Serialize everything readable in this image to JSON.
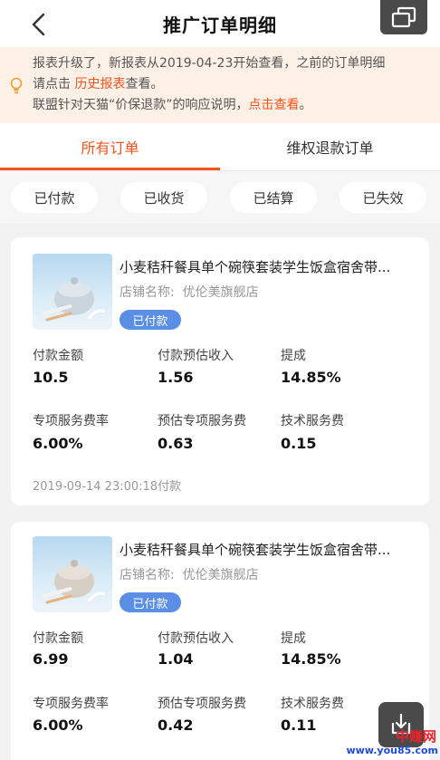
{
  "header": {
    "title": "推广订单明细"
  },
  "notice": {
    "line1": "报表升级了，新报表从2019-04-23开始查看，之前的订单明细",
    "line2_prefix": "请点击 ",
    "line2_link": "历史报表",
    "line2_suffix": "查看。",
    "line3_prefix": "联盟针对天猫“价保退款”的响应说明，",
    "line3_link": "点击查看",
    "line3_suffix": "。"
  },
  "tabs": [
    {
      "label": "所有订单",
      "active": true
    },
    {
      "label": "维权退款订单",
      "active": false
    }
  ],
  "filters": [
    "已付款",
    "已收货",
    "已结算",
    "已失效"
  ],
  "orders": [
    {
      "title": "小麦秸秆餐具单个碗筷套装学生饭盒宿舍带...",
      "shop_label": "店铺名称:",
      "shop": "优伦美旗舰店",
      "status": "已付款",
      "stats": [
        {
          "label": "付款金额",
          "value": "10.5"
        },
        {
          "label": "付款预估收入",
          "value": "1.56"
        },
        {
          "label": "提成",
          "value": "14.85%"
        },
        {
          "label": "专项服务费率",
          "value": "6.00%"
        },
        {
          "label": "预估专项服务费",
          "value": "0.63"
        },
        {
          "label": "技术服务费",
          "value": "0.15"
        }
      ],
      "time": "2019-09-14 23:00:18付款"
    },
    {
      "title": "小麦秸秆餐具单个碗筷套装学生饭盒宿舍带...",
      "shop_label": "店铺名称:",
      "shop": "优伦美旗舰店",
      "status": "已付款",
      "stats": [
        {
          "label": "付款金额",
          "value": "6.99"
        },
        {
          "label": "付款预估收入",
          "value": "1.04"
        },
        {
          "label": "提成",
          "value": "14.85%"
        },
        {
          "label": "专项服务费率",
          "value": "6.00%"
        },
        {
          "label": "预估专项服务费",
          "value": "0.42"
        },
        {
          "label": "技术服务费",
          "value": "0.11"
        }
      ]
    }
  ],
  "watermark": {
    "top": "中赚网",
    "bottom": "www.you85.com"
  },
  "colors": {
    "accent": "#f0541e",
    "badge": "#5b8fe6",
    "notice_bg": "#fdf0e6"
  }
}
